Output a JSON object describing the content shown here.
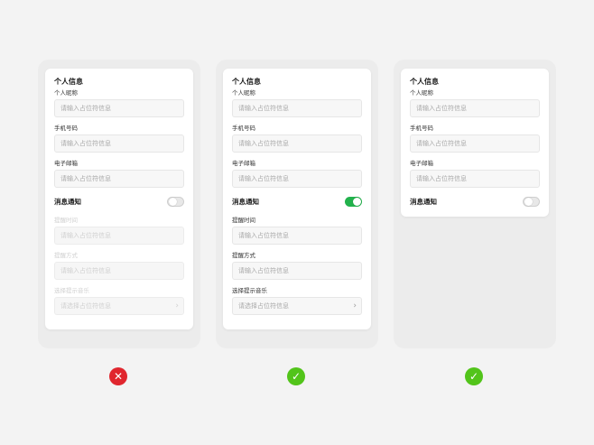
{
  "colors": {
    "error": "#e0262e",
    "success": "#52c41a",
    "toggle_on": "#22b24c"
  },
  "panels": [
    {
      "title": "个人信息",
      "fields": [
        {
          "label": "个人昵称",
          "placeholder": "请输入占位符信息"
        },
        {
          "label": "手机号码",
          "placeholder": "请输入占位符信息"
        },
        {
          "label": "电子邮箱",
          "placeholder": "请输入占位符信息"
        }
      ],
      "notify_label": "消息通知",
      "notify_on": false,
      "extra_fields": [
        {
          "label": "提醒时间",
          "placeholder": "请输入占位符信息"
        },
        {
          "label": "提醒方式",
          "placeholder": "请输入占位符信息"
        },
        {
          "label": "选择提示音乐",
          "placeholder": "请选择占位符信息"
        }
      ],
      "status_icon": "cross-icon",
      "status_glyph": "✕"
    },
    {
      "title": "个人信息",
      "fields": [
        {
          "label": "个人昵称",
          "placeholder": "请输入占位符信息"
        },
        {
          "label": "手机号码",
          "placeholder": "请输入占位符信息"
        },
        {
          "label": "电子邮箱",
          "placeholder": "请输入占位符信息"
        }
      ],
      "notify_label": "消息通知",
      "notify_on": true,
      "extra_fields": [
        {
          "label": "提醒时间",
          "placeholder": "请输入占位符信息"
        },
        {
          "label": "提醒方式",
          "placeholder": "请输入占位符信息"
        },
        {
          "label": "选择提示音乐",
          "placeholder": "请选择占位符信息"
        }
      ],
      "status_icon": "check-icon",
      "status_glyph": "✓"
    },
    {
      "title": "个人信息",
      "fields": [
        {
          "label": "个人昵称",
          "placeholder": "请输入占位符信息"
        },
        {
          "label": "手机号码",
          "placeholder": "请输入占位符信息"
        },
        {
          "label": "电子邮箱",
          "placeholder": "请输入占位符信息"
        }
      ],
      "notify_label": "消息通知",
      "notify_on": false,
      "status_icon": "check-icon",
      "status_glyph": "✓"
    }
  ]
}
